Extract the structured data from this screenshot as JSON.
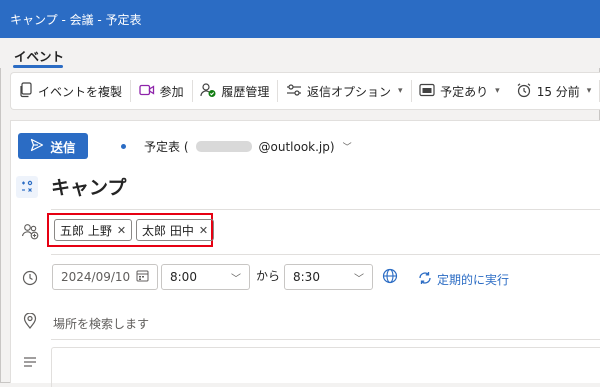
{
  "window": {
    "title": "キャンプ - 会議 - 予定表"
  },
  "tabs": [
    {
      "label": "イベント"
    }
  ],
  "ribbon": {
    "duplicate_label": "イベントを複製",
    "join_label": "参加",
    "history_label": "履歴管理",
    "reply_options_label": "返信オプション",
    "status_label": "予定あり",
    "reminder_label": "15 分前"
  },
  "compose": {
    "send_label": "送信",
    "from_prefix": "予定表 (",
    "from_suffix": "@outlook.jp)",
    "title": "キャンプ",
    "attendees": [
      {
        "name": "五郎 上野"
      },
      {
        "name": "太郎 田中"
      }
    ],
    "date": "2024/09/10",
    "start_time": "8:00",
    "between_label": "から",
    "end_time": "8:30",
    "recurring_label": "定期的に実行",
    "location_placeholder": "場所を検索します"
  },
  "colors": {
    "accent": "#2b6cc4",
    "highlight_border": "#e60012",
    "join_icon": "#8e24aa",
    "history_icon": "#107c10"
  }
}
